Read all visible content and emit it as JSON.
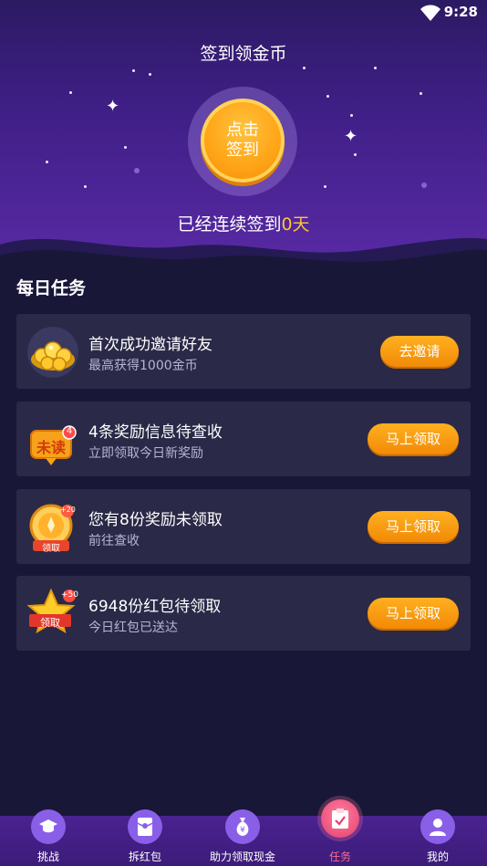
{
  "status_bar": {
    "time": "9:28"
  },
  "hero": {
    "title": "签到领金币",
    "checkin_button": {
      "line1": "点击",
      "line2": "签到"
    },
    "streak_prefix": "已经连续签到",
    "streak_count": "0天"
  },
  "daily_tasks": {
    "heading": "每日任务",
    "items": [
      {
        "icon": "gold-coins-icon",
        "title": "首次成功邀请好友",
        "subtitle": "最高获得1000金币",
        "button": "去邀请"
      },
      {
        "icon": "unread-badge-icon",
        "icon_text": "未读",
        "badge_count": "4",
        "title": "4条奖励信息待查收",
        "subtitle": "立即领取今日新奖励",
        "button": "马上领取"
      },
      {
        "icon": "reward-medal-icon",
        "icon_text": "领取",
        "badge_text": "+20",
        "title": "您有8份奖励未领取",
        "subtitle": "前往查收",
        "button": "马上领取"
      },
      {
        "icon": "red-packet-star-icon",
        "icon_text": "领取",
        "badge_text": "+50",
        "title": "6948份红包待领取",
        "subtitle": "今日红包已送达",
        "button": "马上领取"
      }
    ]
  },
  "tab_bar": {
    "tabs": [
      {
        "icon": "graduation-cap-icon",
        "label": "挑战"
      },
      {
        "icon": "red-envelope-icon",
        "label": "拆红包"
      },
      {
        "icon": "money-bag-icon",
        "label": "助力领取现金"
      },
      {
        "icon": "clipboard-check-icon",
        "label": "任务",
        "active": true
      },
      {
        "icon": "user-icon",
        "label": "我的"
      }
    ]
  },
  "colors": {
    "accent_orange": "#f7a21a",
    "streak_highlight": "#ffc531",
    "active_tab": "#ff6a8d",
    "card_bg": "#2a2947",
    "page_bg": "#191738"
  }
}
